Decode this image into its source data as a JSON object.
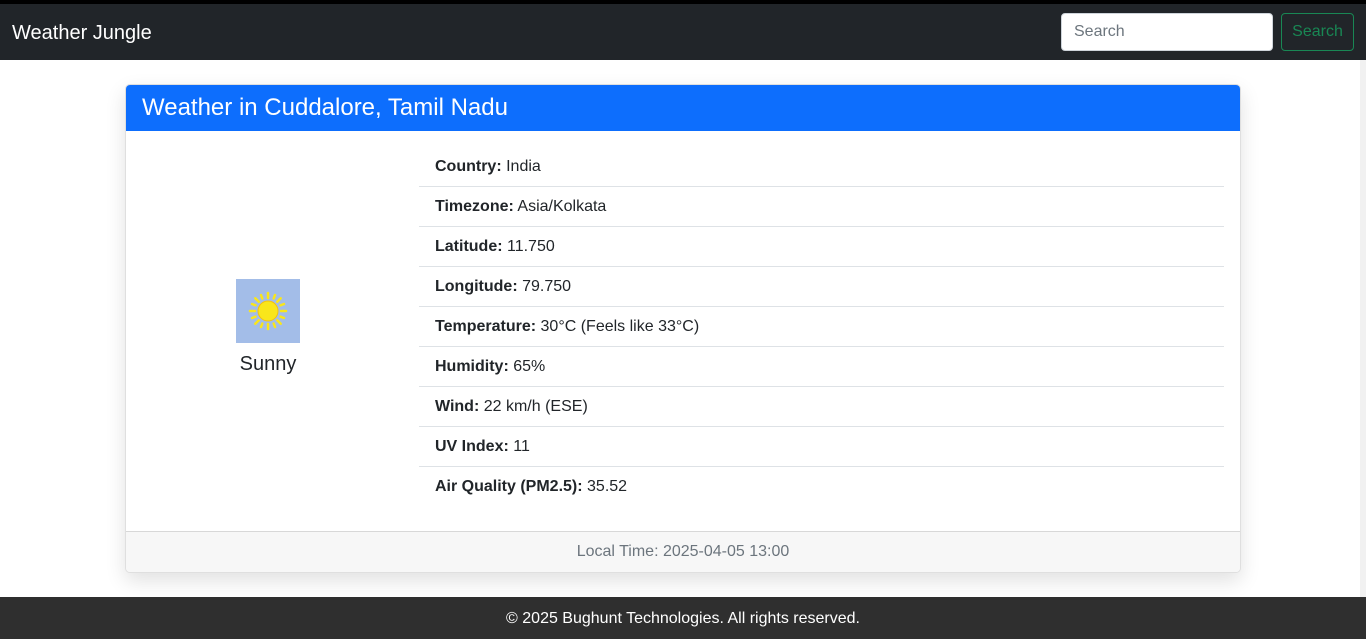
{
  "navbar": {
    "brand": "Weather Jungle",
    "search_placeholder": "Search",
    "search_button": "Search"
  },
  "card": {
    "header": "Weather in Cuddalore, Tamil Nadu",
    "condition": {
      "icon": "sun-icon",
      "label": "Sunny"
    },
    "details": [
      {
        "label": "Country:",
        "value": "India"
      },
      {
        "label": "Timezone:",
        "value": "Asia/Kolkata"
      },
      {
        "label": "Latitude:",
        "value": "11.750"
      },
      {
        "label": "Longitude:",
        "value": "79.750"
      },
      {
        "label": "Temperature:",
        "value": "30°C (Feels like 33°C)"
      },
      {
        "label": "Humidity:",
        "value": "65%"
      },
      {
        "label": "Wind:",
        "value": "22 km/h (ESE)"
      },
      {
        "label": "UV Index:",
        "value": "11"
      },
      {
        "label": "Air Quality (PM2.5):",
        "value": "35.52"
      }
    ],
    "footer": "Local Time: 2025-04-05 13:00"
  },
  "footer": {
    "text": "© 2025 Bughunt Technologies. All rights reserved."
  },
  "colors": {
    "navbar_bg": "#212529",
    "header_bg": "#0d6efd",
    "search_button": "#198754",
    "footer_bg": "#2f2f2f",
    "icon_bg": "#a3bde8",
    "sun": "#f9e61b"
  }
}
